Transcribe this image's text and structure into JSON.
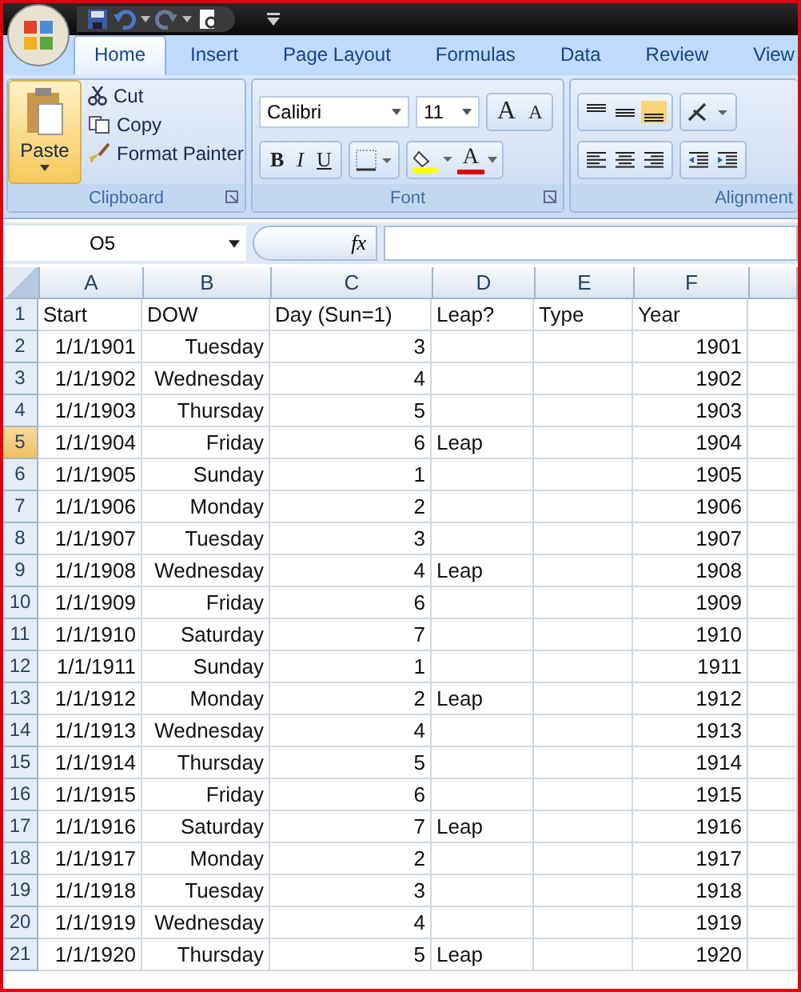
{
  "ribbon_tabs": [
    {
      "label": "Home",
      "selected": true
    },
    {
      "label": "Insert",
      "selected": false
    },
    {
      "label": "Page Layout",
      "selected": false
    },
    {
      "label": "Formulas",
      "selected": false
    },
    {
      "label": "Data",
      "selected": false
    },
    {
      "label": "Review",
      "selected": false
    },
    {
      "label": "View",
      "selected": false
    }
  ],
  "clipboard": {
    "paste": "Paste",
    "cut": "Cut",
    "copy": "Copy",
    "format_painter": "Format Painter",
    "label": "Clipboard"
  },
  "font": {
    "name": "Calibri",
    "size": "11",
    "grow": "A",
    "shrink": "A",
    "bold": "B",
    "italic": "I",
    "underline": "U",
    "font_color": "A",
    "label": "Font"
  },
  "alignment": {
    "label": "Alignment"
  },
  "name_box": "O5",
  "fx": "fx",
  "columns": [
    "A",
    "B",
    "C",
    "D",
    "E",
    "F"
  ],
  "rows": [
    {
      "number": "1",
      "selected": false,
      "cells": [
        "Start",
        "DOW",
        "Day (Sun=1)",
        "Leap?",
        "Type",
        "Year"
      ]
    },
    {
      "number": "2",
      "selected": false,
      "cells": [
        "1/1/1901",
        "Tuesday",
        "3",
        null,
        null,
        "1901"
      ]
    },
    {
      "number": "3",
      "selected": false,
      "cells": [
        "1/1/1902",
        "Wednesday",
        "4",
        null,
        null,
        "1902"
      ]
    },
    {
      "number": "4",
      "selected": false,
      "cells": [
        "1/1/1903",
        "Thursday",
        "5",
        null,
        null,
        "1903"
      ]
    },
    {
      "number": "5",
      "selected": true,
      "cells": [
        "1/1/1904",
        "Friday",
        "6",
        "Leap",
        null,
        "1904"
      ]
    },
    {
      "number": "6",
      "selected": false,
      "cells": [
        "1/1/1905",
        "Sunday",
        "1",
        null,
        null,
        "1905"
      ]
    },
    {
      "number": "7",
      "selected": false,
      "cells": [
        "1/1/1906",
        "Monday",
        "2",
        null,
        null,
        "1906"
      ]
    },
    {
      "number": "8",
      "selected": false,
      "cells": [
        "1/1/1907",
        "Tuesday",
        "3",
        null,
        null,
        "1907"
      ]
    },
    {
      "number": "9",
      "selected": false,
      "cells": [
        "1/1/1908",
        "Wednesday",
        "4",
        "Leap",
        null,
        "1908"
      ]
    },
    {
      "number": "10",
      "selected": false,
      "cells": [
        "1/1/1909",
        "Friday",
        "6",
        null,
        null,
        "1909"
      ]
    },
    {
      "number": "11",
      "selected": false,
      "cells": [
        "1/1/1910",
        "Saturday",
        "7",
        null,
        null,
        "1910"
      ]
    },
    {
      "number": "12",
      "selected": false,
      "cells": [
        "1/1/1911",
        "Sunday",
        "1",
        null,
        null,
        "1911"
      ]
    },
    {
      "number": "13",
      "selected": false,
      "cells": [
        "1/1/1912",
        "Monday",
        "2",
        "Leap",
        null,
        "1912"
      ]
    },
    {
      "number": "14",
      "selected": false,
      "cells": [
        "1/1/1913",
        "Wednesday",
        "4",
        null,
        null,
        "1913"
      ]
    },
    {
      "number": "15",
      "selected": false,
      "cells": [
        "1/1/1914",
        "Thursday",
        "5",
        null,
        null,
        "1914"
      ]
    },
    {
      "number": "16",
      "selected": false,
      "cells": [
        "1/1/1915",
        "Friday",
        "6",
        null,
        null,
        "1915"
      ]
    },
    {
      "number": "17",
      "selected": false,
      "cells": [
        "1/1/1916",
        "Saturday",
        "7",
        "Leap",
        null,
        "1916"
      ]
    },
    {
      "number": "18",
      "selected": false,
      "cells": [
        "1/1/1917",
        "Monday",
        "2",
        null,
        null,
        "1917"
      ]
    },
    {
      "number": "19",
      "selected": false,
      "cells": [
        "1/1/1918",
        "Tuesday",
        "3",
        null,
        null,
        "1918"
      ]
    },
    {
      "number": "20",
      "selected": false,
      "cells": [
        "1/1/1919",
        "Wednesday",
        "4",
        null,
        null,
        "1919"
      ]
    },
    {
      "number": "21",
      "selected": false,
      "cells": [
        "1/1/1920",
        "Thursday",
        "5",
        "Leap",
        null,
        "1920"
      ]
    }
  ]
}
